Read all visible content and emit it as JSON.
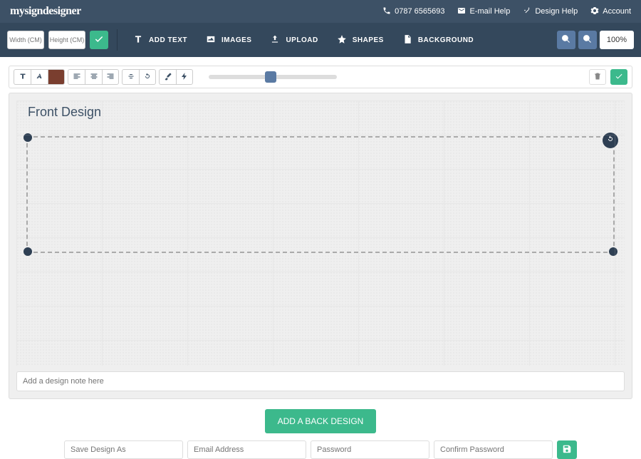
{
  "brand": "mysigndesigner",
  "header": {
    "phone": "0787 6565693",
    "email_help": "E-mail Help",
    "design_help": "Design Help",
    "account": "Account"
  },
  "toolbar": {
    "width_placeholder": "Width (CM)",
    "height_placeholder": "Height (CM)",
    "add_text": "ADD TEXT",
    "images": "IMAGES",
    "upload": "UPLOAD",
    "shapes": "SHAPES",
    "background": "BACKGROUND",
    "zoom_pct": "100%"
  },
  "canvas": {
    "title": "Front Design",
    "note_placeholder": "Add a design note here"
  },
  "actions": {
    "add_back": "ADD A BACK DESIGN"
  },
  "save": {
    "name_placeholder": "Save Design As",
    "email_placeholder": "Email Address",
    "password_placeholder": "Password",
    "confirm_placeholder": "Confirm Password"
  }
}
